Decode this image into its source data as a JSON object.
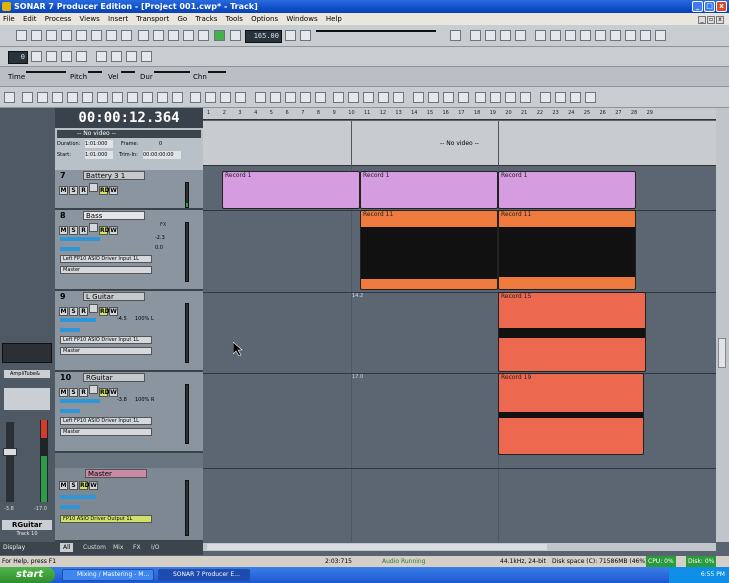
{
  "window": {
    "title": "SONAR 7 Producer Edition - [Project 001.cwp* - Track]"
  },
  "menu": [
    "File",
    "Edit",
    "Process",
    "Views",
    "Insert",
    "Transport",
    "Go",
    "Tracks",
    "Tools",
    "Options",
    "Windows",
    "Help"
  ],
  "transport": {
    "tempo": "165.00",
    "position": "0"
  },
  "event_fields": {
    "time": "Time",
    "pitch": "Pitch",
    "vel": "Vel",
    "dur": "Dur",
    "chn": "Chn"
  },
  "clock": {
    "time": "00:00:12.364"
  },
  "video": {
    "label": "-- No video --",
    "duration_label": "Duration:",
    "duration": "1:01:000",
    "frame_label": "Frame:",
    "frame": "0",
    "start_label": "Start:",
    "start": "1:01:000",
    "trimin_label": "Trim-In:",
    "trimin": "00:00:00:00",
    "no_video_center": "-- No video --"
  },
  "tracks": [
    {
      "num": "7",
      "name": "Battery 3 1",
      "m": "M",
      "s": "S",
      "r": "R",
      "rd": "RD",
      "w": "W"
    },
    {
      "num": "8",
      "name": "Bass",
      "vol": "-2.3",
      "pan": "0.0",
      "input": "Left FP10 ASIO Driver Input 1L",
      "output": "Master"
    },
    {
      "num": "9",
      "name": "L Guitar",
      "vol": "-4.5",
      "pan": "100% L",
      "input": "Left FP10 ASIO Driver Input 1L",
      "output": "Master"
    },
    {
      "num": "10",
      "name": "RGuitar",
      "vol": "-3.8",
      "pan": "100% R",
      "input": "Left FP10 ASIO Driver Input 1L",
      "output": "Master"
    },
    {
      "num": "",
      "name": "Master",
      "output": "FP10 ASIO Driver Output 1L"
    }
  ],
  "ruler_marks": [
    "1",
    "2",
    "3",
    "4",
    "5",
    "6",
    "7",
    "8",
    "9",
    "10",
    "11",
    "12",
    "13",
    "14",
    "15",
    "16",
    "17",
    "18",
    "19",
    "20",
    "21",
    "22",
    "23",
    "24",
    "25",
    "26",
    "27",
    "28",
    "29"
  ],
  "clips": {
    "r1a": "Record 1",
    "r1b": "Record 1",
    "r1c": "Record 1",
    "r11a": "Record 11",
    "r11b": "Record 11",
    "r15": "Record 15",
    "r19": "Record 19",
    "m14": "14.2",
    "m17": "17.0"
  },
  "left": {
    "fx_label": "AmpliTube&",
    "strip_name": "RGuitar",
    "strip_track": "Track 10",
    "strip_val1": "-3.8",
    "strip_val2": "-17.0",
    "display": "Display"
  },
  "bottom_tabs": [
    "All",
    "Custom",
    "Mix",
    "FX",
    "I/O"
  ],
  "status": {
    "help": "For Help, press F1",
    "pos": "2:03:715",
    "audio": "Audio Running",
    "rate": "44.1kHz, 24-bit",
    "disk": "Disk space (C): 71586MB (46%)",
    "cpu": "CPU: 0%",
    "diskpct": "Disk: 0%"
  },
  "taskbar": {
    "start": "start",
    "item1": "Mixing / Mastering - M...",
    "item2": "SONAR 7 Producer E...",
    "clock": "6:55 PM"
  }
}
